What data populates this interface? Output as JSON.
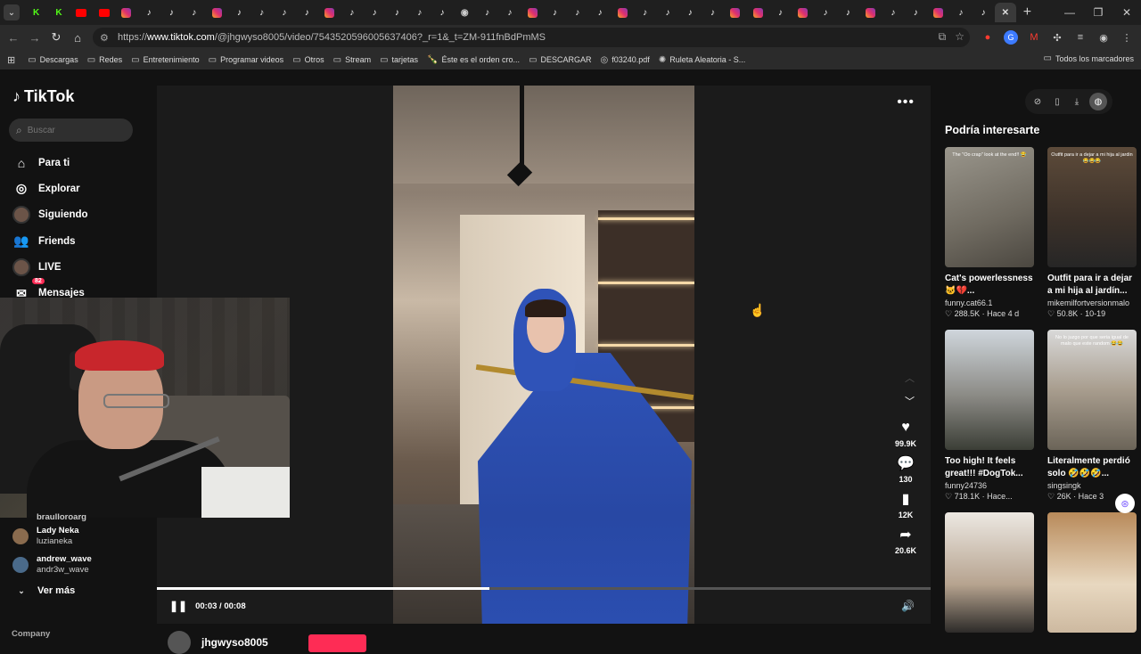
{
  "browser": {
    "tabs": [
      "k",
      "k",
      "yt",
      "yt",
      "ig",
      "tt",
      "tt",
      "tt",
      "ig",
      "tt",
      "tt",
      "tt",
      "tt",
      "ig",
      "tt",
      "tt",
      "tt",
      "tt",
      "tt",
      "wa",
      "tt",
      "tt",
      "ig",
      "tt",
      "tt",
      "tt",
      "ig",
      "tt",
      "tt",
      "tt",
      "tt",
      "ig",
      "ig",
      "tt",
      "ig",
      "tt",
      "tt",
      "ig",
      "tt",
      "tt",
      "ig",
      "tt",
      "tt"
    ],
    "url_prefix": "https://",
    "url_host": "www.tiktok.com",
    "url_path": "/@jhgwyso8005/video/7543520596005637406?_r=1&_t=ZM-911fnBdPmMS",
    "bookmarks": [
      {
        "label": "Descargas",
        "icon": "folder-icon"
      },
      {
        "label": "Redes",
        "icon": "folder-icon"
      },
      {
        "label": "Entretenimiento",
        "icon": "folder-icon"
      },
      {
        "label": "Programar videos",
        "icon": "folder-icon"
      },
      {
        "label": "Otros",
        "icon": "folder-icon"
      },
      {
        "label": "Stream",
        "icon": "folder-icon"
      },
      {
        "label": "tarjetas",
        "icon": "folder-icon"
      },
      {
        "label": "Éste es el orden cro...",
        "icon": "bottle-icon"
      },
      {
        "label": "DESCARGAR",
        "icon": "folder-icon"
      },
      {
        "label": "f03240.pdf",
        "icon": "globe-icon"
      },
      {
        "label": "Ruleta Aleatoria - S...",
        "icon": "wheel-icon"
      }
    ],
    "all_bookmarks": "Todos los marcadores"
  },
  "sidebar": {
    "logo": "TikTok",
    "search_placeholder": "Buscar",
    "nav": [
      {
        "label": "Para ti",
        "icon": "home-icon"
      },
      {
        "label": "Explorar",
        "icon": "compass-icon"
      },
      {
        "label": "Siguiendo",
        "icon": "following-avatar-icon"
      },
      {
        "label": "Friends",
        "icon": "friends-icon"
      },
      {
        "label": "LIVE",
        "icon": "live-avatar-icon"
      },
      {
        "label": "Mensajes",
        "icon": "messages-icon",
        "badge": "82"
      }
    ],
    "following_partial": "braulloroarg",
    "following": [
      {
        "name": "Lady Neka",
        "user": "luzianeka",
        "color": "#8a6b4e"
      },
      {
        "name": "andrew_wave",
        "user": "andr3w_wave",
        "color": "#4a6a8a"
      }
    ],
    "see_more": "Ver más",
    "company": "Company"
  },
  "video": {
    "likes": "99.9K",
    "comments": "130",
    "saves": "12K",
    "shares": "20.6K",
    "time": "00:03 / 00:08",
    "progress": 0.43,
    "author": "jhgwyso8005"
  },
  "recommendations": {
    "title": "Podría interesarte",
    "items": [
      {
        "title": "Cat's powerlessness 🐱💔...",
        "user": "funny.cat66.1",
        "meta": "♡ 288.5K · Hace 4 d",
        "caption": "The \"Oo crap\" look at the end!! 😂",
        "thumb": "th1"
      },
      {
        "title": "Outfit para ir a dejar a mi hija al jardín...",
        "user": "mikemilfortversionmalo",
        "meta": "♡ 50.8K · 10-19",
        "caption": "Outfit para ir a dejar a mi hija al jardin 😂😂😂",
        "thumb": "th2"
      },
      {
        "title": "Too high! It feels great!!! #DogTok...",
        "user": "funny24736",
        "meta": "♡ 718.1K · Hace...",
        "caption": "",
        "thumb": "th3"
      },
      {
        "title": "Literalmente perdió solo 🤣🤣🤣...",
        "user": "singsingk",
        "meta": "♡ 26K · Hace 3",
        "caption": "No lo juzgo por que seria igual de malo que este random 😂😂",
        "thumb": "th4"
      },
      {
        "title": "",
        "user": "",
        "meta": "",
        "caption": "",
        "thumb": "th5"
      },
      {
        "title": "",
        "user": "",
        "meta": "",
        "caption": "",
        "thumb": "th6"
      }
    ]
  }
}
